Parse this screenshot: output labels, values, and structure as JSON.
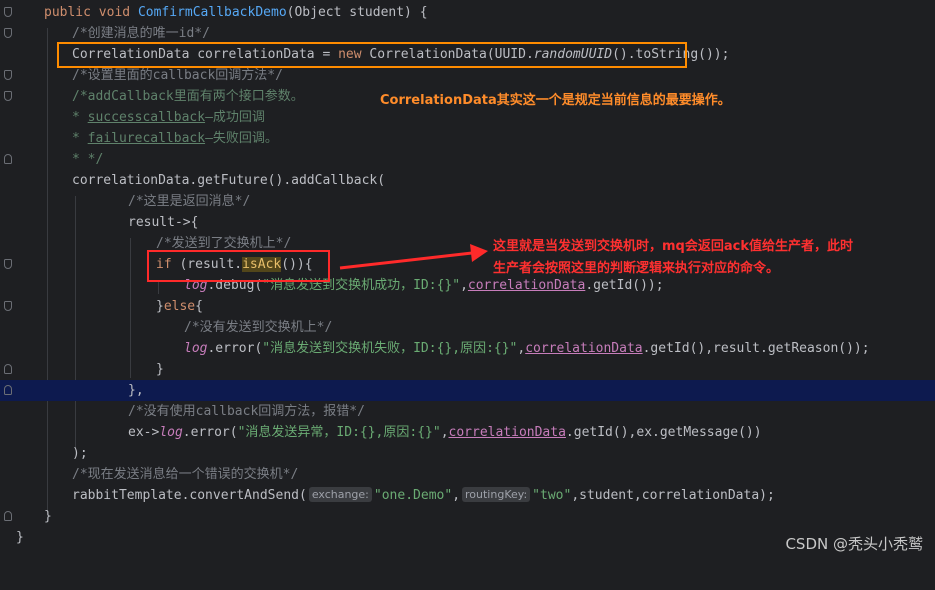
{
  "code": {
    "method_sig": {
      "kw1": "public",
      "kw2": "void",
      "name": "ComfirmCallbackDemo",
      "params": "(Object student) {"
    },
    "c1": "/*创建消息的唯一id*/",
    "l2": {
      "a": "CorrelationData correlationData = ",
      "kw": "new",
      "b": " CorrelationData(UUID.",
      "it": "randomUUID",
      "c": "().toString());"
    },
    "c3": "/*设置里面的callback回调方法*/",
    "c4": "/*addCallback里面有两个接口参数。",
    "c5": "* ",
    "c5b": "successcallback",
    "c5c": "—成功回调",
    "c6": "* ",
    "c6b": "failurecallback",
    "c6c": "—失败回调。",
    "c7": "* */",
    "l8": "correlationData.getFuture().addCallback(",
    "c9": "/*这里是返回消息*/",
    "l10": "result->{",
    "c11": "/*发送到了交换机上*/",
    "l12": {
      "kw": "if",
      "a": " (result.",
      "b": "isAck",
      "c": "()){"
    },
    "l13": {
      "fld": "log",
      "a": ".debug(",
      "str": "\"消息发送到交换机成功，ID:{}\"",
      "b": ",",
      "und": "correlationData",
      "c": ".getId());"
    },
    "l14": {
      "a": "}",
      "kw": "else",
      "b": "{"
    },
    "c15": "/*没有发送到交换机上*/",
    "l16": {
      "fld": "log",
      "a": ".error(",
      "str": "\"消息发送到交换机失败，ID:{},原因:{}\"",
      "b": ",",
      "und": "correlationData",
      "c": ".getId(),result.getReason());"
    },
    "l17": "}",
    "l18": "},",
    "c19": "/*没有使用callback回调方法，报错*/",
    "l20": {
      "a": "ex->",
      "fld": "log",
      "b": ".error(",
      "str": "\"消息发送异常，ID:{},原因:{}\"",
      "c": ",",
      "und": "correlationData",
      "d": ".getId(),ex.getMessage())"
    },
    "l21": ");",
    "c22": "/*现在发送消息给一个错误的交换机*/",
    "l23": {
      "a": "rabbitTemplate.convertAndSend(",
      "h1": "exchange:",
      "s1": "\"one.Demo\"",
      "b": ",",
      "h2": "routingKey:",
      "s2": "\"two\"",
      "c": ",student,correlationData);"
    },
    "l24": "}",
    "l25": "}"
  },
  "annotations": {
    "note1": "CorrelationData其实这一个是规定当前信息的最要操作。",
    "note2_line1": "这里就是当发送到交换机时，mq会返回ack值给生产者，此时",
    "note2_line2": "生产者会按照这里的判断逻辑来执行对应的命令。"
  },
  "watermark": "CSDN @秃头小秃鹫",
  "colors": {
    "orange_box": "#ff8c00",
    "red_box": "#ff2a2a",
    "note1": "#ff8c2a",
    "note2": "#ff3030"
  }
}
